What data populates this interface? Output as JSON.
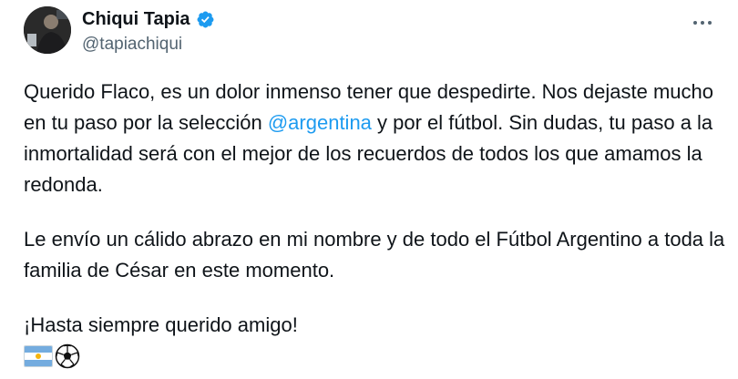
{
  "author": {
    "name": "Chiqui Tapia",
    "handle": "@tapiachiqui",
    "verified": true,
    "verified_color": "#1d9bf0"
  },
  "tweet": {
    "p1_part1": "Querido Flaco, es un dolor inmenso tener que despedirte. Nos dejaste mucho en tu paso por la selección ",
    "p1_mention": "@argentina",
    "p1_part2": " y por el fútbol. Sin dudas, tu paso a la inmortalidad será con el mejor de los recuerdos de todos los que amamos la redonda.",
    "p2": "Le envío un cálido abrazo en mi nombre y de todo el Fútbol Argentino a toda la familia de César en este momento.",
    "p3": "¡Hasta siempre querido amigo!",
    "emojis": [
      "argentina-flag",
      "soccer-ball"
    ]
  },
  "colors": {
    "text": "#0f1419",
    "secondary": "#536471",
    "link": "#1d9bf0"
  }
}
